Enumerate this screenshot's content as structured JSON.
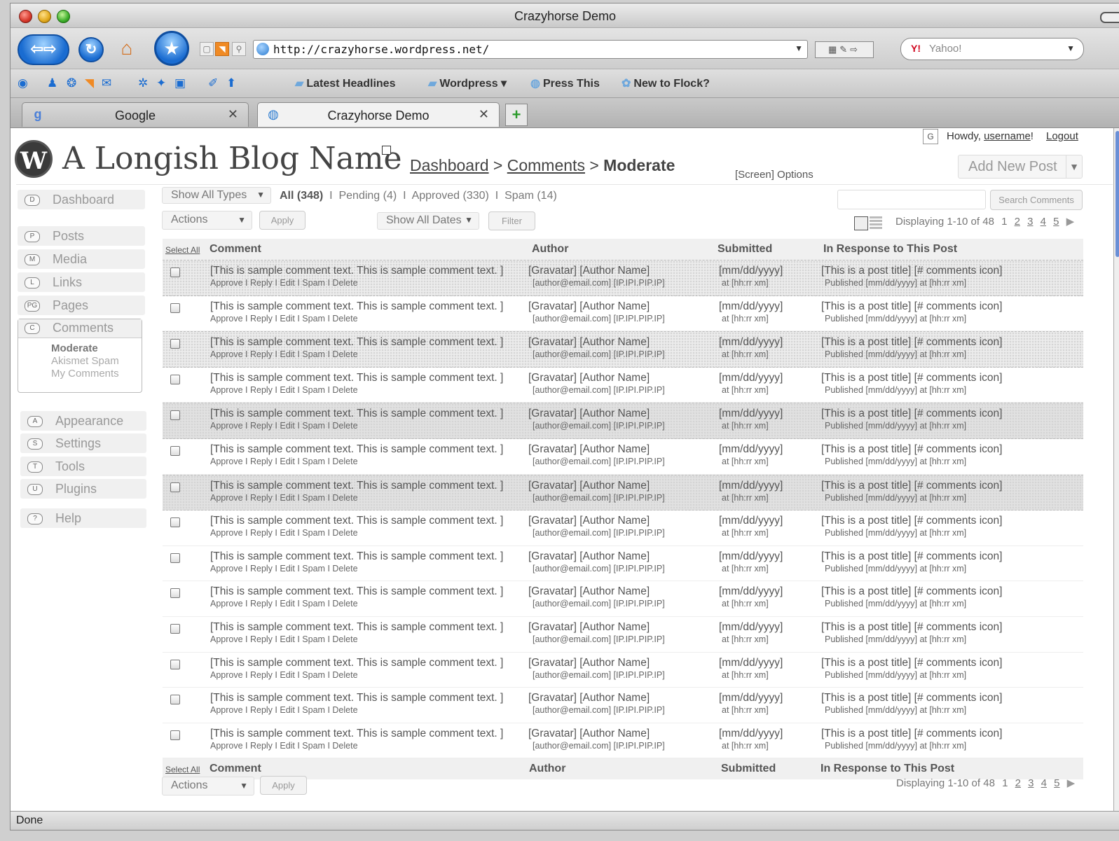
{
  "window": {
    "title": "Crazyhorse Demo"
  },
  "browser": {
    "url": "http://crazyhorse.wordpress.net/",
    "search_engine": "Yahoo!",
    "bookmarks": [
      {
        "label": "Latest Headlines",
        "icon": "folder-icon"
      },
      {
        "label": "Wordpress ▾",
        "icon": "folder-icon"
      },
      {
        "label": "Press This",
        "icon": "globe-icon"
      },
      {
        "label": "New to Flock?",
        "icon": "flock-icon"
      }
    ],
    "tabs": [
      {
        "label": "Google",
        "icon": "google-icon",
        "active": false
      },
      {
        "label": "Crazyhorse Demo",
        "icon": "globe-icon",
        "active": true
      }
    ],
    "status": "Done"
  },
  "header": {
    "howdy_prefix": "Howdy, ",
    "username": "username",
    "howdy_suffix": "!",
    "logout": "Logout",
    "blog_name": "A Longish Blog Name",
    "breadcrumb": {
      "dashboard": "Dashboard",
      "sep": " > ",
      "comments": "Comments",
      "current": "Moderate"
    },
    "screen_options": "[Screen] Options",
    "add_new_post": "Add New Post"
  },
  "sidebar": {
    "items": [
      {
        "key": "D",
        "label": "Dashboard"
      },
      {
        "key": "P",
        "label": "Posts"
      },
      {
        "key": "M",
        "label": "Media"
      },
      {
        "key": "L",
        "label": "Links"
      },
      {
        "key": "PG",
        "label": "Pages"
      },
      {
        "key": "C",
        "label": "Comments"
      },
      {
        "key": "A",
        "label": "Appearance"
      },
      {
        "key": "S",
        "label": "Settings"
      },
      {
        "key": "T",
        "label": "Tools"
      },
      {
        "key": "U",
        "label": "Plugins"
      },
      {
        "key": "?",
        "label": "Help"
      }
    ],
    "comments_submenu": [
      "Moderate",
      "Akismet Spam",
      "My Comments"
    ]
  },
  "filters": {
    "type_select": "Show All Types",
    "all": "All (348)",
    "pending": "Pending (4)",
    "approved": "Approved (330)",
    "spam": "Spam (14)",
    "sep": "I",
    "actions": "Actions",
    "apply": "Apply",
    "dates": "Show All Dates",
    "filter": "Filter",
    "search_button": "Search Comments",
    "displaying": "Displaying 1-10 of 48",
    "pages": [
      "1",
      "2",
      "3",
      "4",
      "5"
    ]
  },
  "table": {
    "select_all": "Select All",
    "headers": {
      "comment": "Comment",
      "author": "Author",
      "submitted": "Submitted",
      "response": "In Response to This Post"
    },
    "row": {
      "comment": "[This is sample comment text. This is sample comment text. ]",
      "actions": "Approve I Reply I Edit I Spam I Delete",
      "author": "[Gravatar] [Author Name]",
      "email": "[author@email.com] [IP.IPI.PIP.IP]",
      "date": "[mm/dd/yyyy]",
      "time": "at [hh:rr xm]",
      "post": "[This is a post title]  [# comments icon]",
      "published": "Published [mm/dd/yyyy] at [hh:rr xm]"
    },
    "row_count": 14,
    "highlighted_rows": [
      0,
      2,
      4,
      6
    ],
    "darker_rows": [
      4,
      6
    ]
  }
}
